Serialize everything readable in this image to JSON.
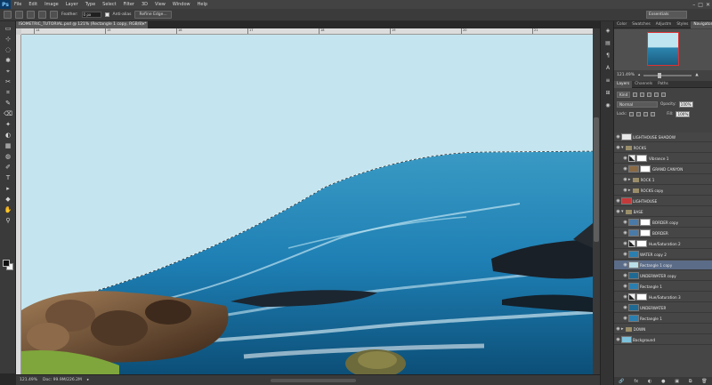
{
  "app": {
    "logo": "Ps"
  },
  "menu": [
    "File",
    "Edit",
    "Image",
    "Layer",
    "Type",
    "Select",
    "Filter",
    "3D",
    "View",
    "Window",
    "Help"
  ],
  "window_controls": [
    "–",
    "□",
    "✕"
  ],
  "options": {
    "feather_label": "Feather:",
    "feather_value": "0 px",
    "antialias_label": "Anti-alias",
    "refine_button": "Refine Edge...",
    "workspace": "Essentials"
  },
  "document": {
    "tab_title": "ISOMETRIC_TUTORIAL.psd @ 121% (Rectangle 1 copy, RGB/8) *",
    "tab_close": "×",
    "ruler_ticks": [
      "14",
      "15",
      "16",
      "17",
      "18",
      "19",
      "20",
      "21"
    ]
  },
  "status": {
    "zoom": "121.49%",
    "doc_info": "Doc: 99.9M/226.2M",
    "arrow": "▸"
  },
  "panels": {
    "top_tabs": [
      "Color",
      "Swatches",
      "Adjustm",
      "Styles",
      "Navigator"
    ],
    "navigator_zoom": "121.49%",
    "layer_tabs": [
      "Layers",
      "Channels",
      "Paths"
    ],
    "kind_label": "Kind",
    "blend_mode": "Normal",
    "opacity_label": "Opacity:",
    "opacity_value": "100%",
    "lock_label": "Lock:",
    "fill_label": "Fill:",
    "fill_value": "100%"
  },
  "layers": [
    {
      "name": "LIGHTHOUSE SHADOW",
      "type": "layer",
      "thumb": "#e8e8e8"
    },
    {
      "name": "ROCKS",
      "type": "group",
      "thumb": ""
    },
    {
      "name": "Vibrance 1",
      "type": "adjustment",
      "thumb": ""
    },
    {
      "name": "GRAND CANYON",
      "type": "layer",
      "thumb": "#8a6a45"
    },
    {
      "name": "ROCK 1",
      "type": "group",
      "thumb": ""
    },
    {
      "name": "ROCKS copy",
      "type": "group",
      "thumb": ""
    },
    {
      "name": "LIGHTHOUSE",
      "type": "layer",
      "thumb": "#c43a3a"
    },
    {
      "name": "BASE",
      "type": "group",
      "thumb": ""
    },
    {
      "name": "BORDER copy",
      "type": "layer",
      "thumb": "#4a7aa8"
    },
    {
      "name": "BORDER",
      "type": "layer",
      "thumb": "#4a7aa8"
    },
    {
      "name": "Hue/Saturation 2",
      "type": "adjustment",
      "thumb": ""
    },
    {
      "name": "WATER copy 2",
      "type": "layer",
      "thumb": "#2a7fb0"
    },
    {
      "name": "Rectangle 1 copy",
      "type": "layer",
      "thumb": "#b9dde9"
    },
    {
      "name": "UNDERWATER copy",
      "type": "layer",
      "thumb": "#1f6a94"
    },
    {
      "name": "Rectangle 1",
      "type": "layer",
      "thumb": "#2a7fb0"
    },
    {
      "name": "Hue/Saturation 3",
      "type": "adjustment",
      "thumb": ""
    },
    {
      "name": "UNDERWATER",
      "type": "layer",
      "thumb": "#1f6a94"
    },
    {
      "name": "Rectangle 1",
      "type": "layer",
      "thumb": "#2a7fb0"
    },
    {
      "name": "DOWN",
      "type": "group",
      "thumb": ""
    },
    {
      "name": "Background",
      "type": "layer",
      "thumb": "#7cc2dc"
    }
  ],
  "layer_footer_icons": [
    "🔗",
    "fx",
    "◐",
    "●",
    "▣",
    "⧉",
    "🗑"
  ],
  "tools": [
    "▭",
    "⊹",
    "◌",
    "✱",
    "⌖",
    "✂",
    "⌗",
    "✎",
    "⌫",
    "✦",
    "◐",
    "▦",
    "◍",
    "✐",
    "T",
    "▸",
    "◆",
    "✋",
    "⚲"
  ],
  "strip_icons": [
    "◈",
    "▤",
    "¶",
    "A",
    "≡",
    "⊞",
    "◉"
  ],
  "colors": {
    "sky": "#c4e5ef",
    "sea": "#1e7fb4",
    "deep_sea": "#0c4f78",
    "rock": "#5a3f2c",
    "grass": "#7ea63c",
    "selection_row": "#5b6c88"
  }
}
